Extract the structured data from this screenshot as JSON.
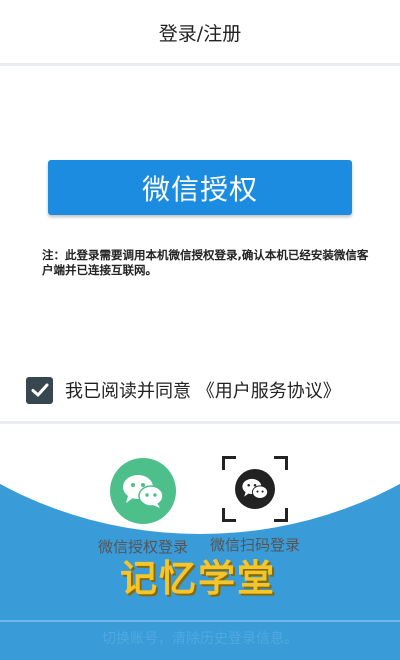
{
  "header": {
    "title": "登录/注册"
  },
  "main": {
    "wechat_auth_button": "微信授权",
    "note": "注：此登录需要调用本机微信授权登录,确认本机已经安装微信客户端并已连接互联网。"
  },
  "agreement": {
    "checked": true,
    "text": "我已阅读并同意 《用户服务协议》"
  },
  "login_options": [
    {
      "label": "微信授权登录",
      "icon": "wechat-icon"
    },
    {
      "label": "微信扫码登录",
      "icon": "wechat-scan-icon"
    }
  ],
  "watermark": {
    "text": "记忆学堂"
  },
  "footer": {
    "switch_account": "切换账号，清除历史登录信息。"
  },
  "colors": {
    "primary_blue": "#1b8ce0",
    "bottom_blue": "#3a9bd9",
    "wechat_green": "#4cbf8a",
    "checkbox_dark": "#37474f",
    "watermark_yellow": "#f6c52a"
  }
}
